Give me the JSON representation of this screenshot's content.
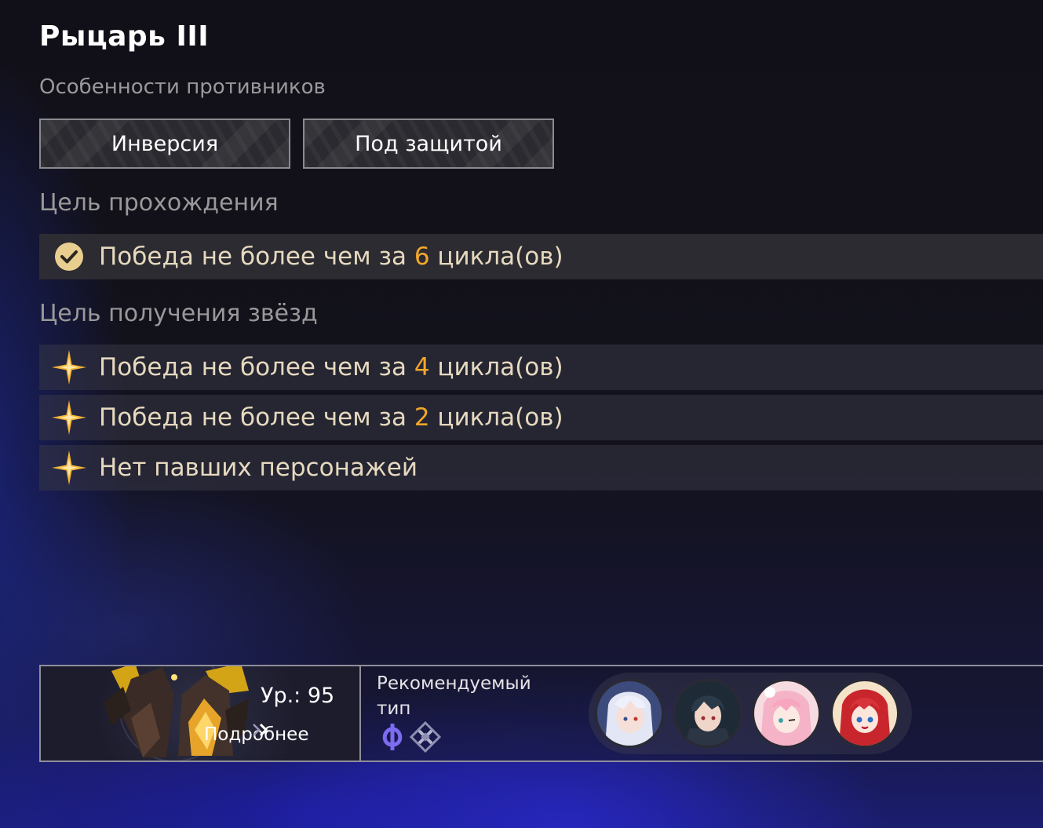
{
  "title": "Рыцарь III",
  "enemy_features": {
    "label": "Особенности противников",
    "traits": [
      "Инверсия",
      "Под защитой"
    ]
  },
  "clear_goal": {
    "label": "Цель прохождения",
    "pre": "Победа не более чем за ",
    "num": "6",
    "post": " цикла(ов)"
  },
  "star_goals": {
    "label": "Цель получения звёзд",
    "items": [
      {
        "pre": "Победа не более чем за ",
        "num": "4",
        "post": " цикла(ов)"
      },
      {
        "pre": "Победа не более чем за ",
        "num": "2",
        "post": " цикла(ов)"
      },
      {
        "pre": "Нет павших персонажей",
        "num": "",
        "post": ""
      }
    ]
  },
  "enemy_panel": {
    "level": "Ур.: 95",
    "details": "Подробнее"
  },
  "recommended": {
    "label": "Рекомендуемый тип",
    "types": [
      "imaginary-path-icon",
      "quantum-type-icon"
    ]
  },
  "avatars": [
    "character-avatar-1",
    "character-avatar-2",
    "character-avatar-3",
    "character-avatar-4"
  ],
  "colors": {
    "accent_number": "#f3a72a",
    "goal_text": "#e6d9bf",
    "check_circle": "#e9cf8f"
  }
}
